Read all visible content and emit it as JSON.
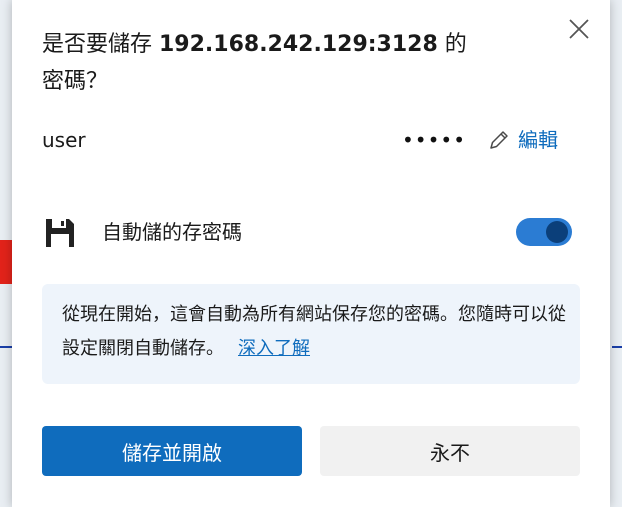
{
  "dialog": {
    "title_prefix": "是否要儲存 ",
    "title_host": "192.168.242.129:3128",
    "title_suffix": " 的密碼？",
    "close_label": "×"
  },
  "credential": {
    "username": "user",
    "password_mask": "•••••",
    "edit_label": "編輯"
  },
  "autosave": {
    "label": "自動儲的存密碼",
    "enabled": true
  },
  "info": {
    "text": "從現在開始，這會自動為所有網站保存您的密碼。您隨時可以從設定關閉自動儲存。",
    "learn_more": "深入了解"
  },
  "buttons": {
    "save_and_enable": "儲存並開啟",
    "never": "永不"
  },
  "colors": {
    "accent": "#0f6cbd",
    "toggle_on": "#2b7cd3",
    "info_bg": "#eef4fb"
  },
  "icons": {
    "close": "close-icon",
    "edit": "pencil-icon",
    "save": "floppy-disk-icon"
  }
}
